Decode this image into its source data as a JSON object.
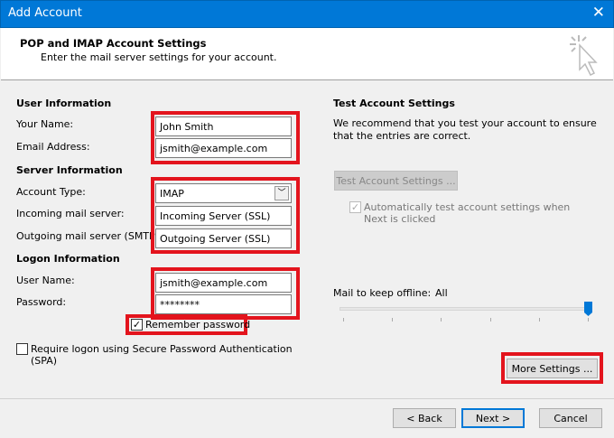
{
  "window": {
    "title": "Add Account"
  },
  "header": {
    "title": "POP and IMAP Account Settings",
    "subtitle": "Enter the mail server settings for your account."
  },
  "user_info": {
    "heading": "User Information",
    "name_label": "Your Name:",
    "name_value": "John Smith",
    "email_label": "Email Address:",
    "email_value": "jsmith@example.com"
  },
  "server_info": {
    "heading": "Server Information",
    "account_type_label": "Account Type:",
    "account_type_value": "IMAP",
    "incoming_label": "Incoming mail server:",
    "incoming_value": "Incoming Server (SSL)",
    "outgoing_label": "Outgoing mail server (SMTP):",
    "outgoing_value": "Outgoing Server (SSL)"
  },
  "logon_info": {
    "heading": "Logon Information",
    "username_label": "User Name:",
    "username_value": "jsmith@example.com",
    "password_label": "Password:",
    "password_value": "********",
    "remember_label": "Remember password",
    "spa_label": "Require logon using Secure Password Authentication (SPA)"
  },
  "test": {
    "heading": "Test Account Settings",
    "description": "We recommend that you test your account to ensure that the entries are correct.",
    "button": "Test Account Settings ...",
    "auto_label": "Automatically test account settings when Next is clicked"
  },
  "offline": {
    "label": "Mail to keep offline:",
    "value": "All",
    "slider_fraction": 1.0
  },
  "buttons": {
    "more": "More Settings ...",
    "back": "< Back",
    "next": "Next >",
    "cancel": "Cancel"
  },
  "colors": {
    "titlebar": "#0078d7",
    "highlight": "#e3141d"
  }
}
